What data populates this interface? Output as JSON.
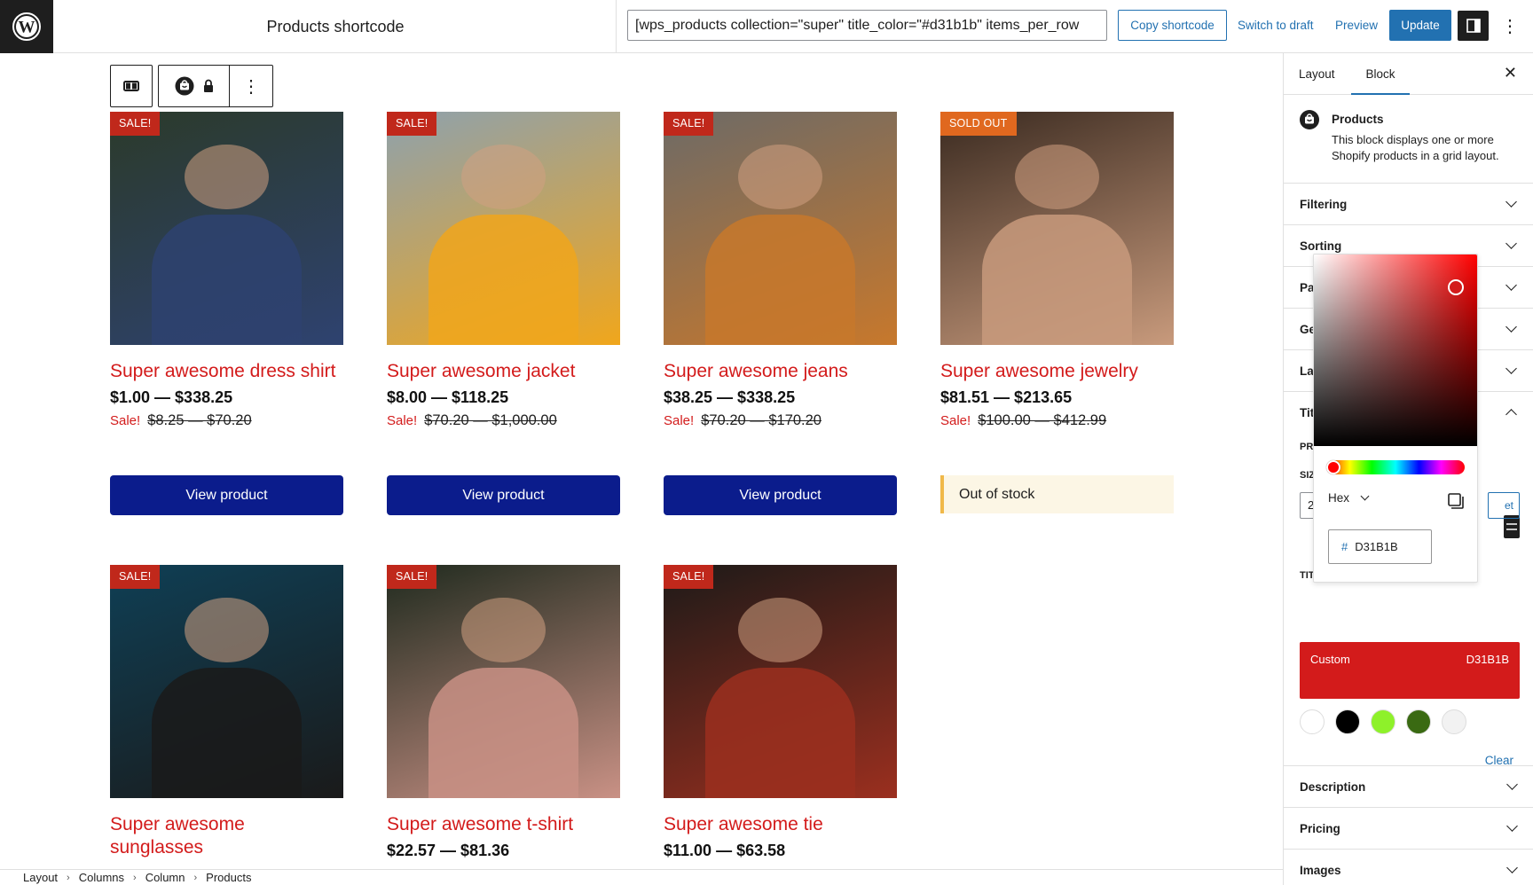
{
  "header": {
    "document_title": "Products shortcode",
    "shortcode_value": "[wps_products collection=\"super\" title_color=\"#d31b1b\" items_per_row",
    "copy_shortcode_label": "Copy shortcode",
    "switch_to_draft_label": "Switch to draft",
    "preview_label": "Preview",
    "update_label": "Update",
    "more_options_glyph": "⋮"
  },
  "block_toolbar": {
    "more_glyph": "⋮"
  },
  "products": [
    {
      "title": "Super awesome dress shirt",
      "badge": "SALE!",
      "price": "$1.00 — $338.25",
      "sale_label": "Sale!",
      "original_price": "$8.25 — $70.20",
      "action": "View product",
      "image_colors": [
        "#2b3a2a",
        "#2e4270"
      ]
    },
    {
      "title": "Super awesome jacket",
      "badge": "SALE!",
      "price": "$8.00 — $118.25",
      "sale_label": "Sale!",
      "original_price": "$70.20 — $1,000.00",
      "action": "View product",
      "image_colors": [
        "#8ea1ad",
        "#f0a61c"
      ]
    },
    {
      "title": "Super awesome jeans",
      "badge": "SALE!",
      "price": "$38.25 — $338.25",
      "sale_label": "Sale!",
      "original_price": "$70.20 — $170.20",
      "action": "View product",
      "image_colors": [
        "#6d6a66",
        "#c7782c"
      ]
    },
    {
      "title": "Super awesome jewelry",
      "badge": "SOLD OUT",
      "price": "$81.51 — $213.65",
      "sale_label": "Sale!",
      "original_price": "$100.00 — $412.99",
      "action": "Out of stock",
      "image_colors": [
        "#3a2a20",
        "#c89a7c"
      ]
    },
    {
      "title": "Super awesome sunglasses",
      "badge": "SALE!",
      "price": "",
      "sale_label": "",
      "original_price": "",
      "action": "",
      "image_colors": [
        "#0f3f55",
        "#1a1a1a"
      ]
    },
    {
      "title": "Super awesome t-shirt",
      "badge": "SALE!",
      "price": "$22.57 — $81.36",
      "sale_label": "",
      "original_price": "",
      "action": "",
      "image_colors": [
        "#1f2a1e",
        "#c99185"
      ]
    },
    {
      "title": "Super awesome tie",
      "badge": "SALE!",
      "price": "$11.00 — $63.58",
      "sale_label": "",
      "original_price": "",
      "action": "",
      "image_colors": [
        "#1d1a18",
        "#9b2f1f"
      ]
    }
  ],
  "breadcrumb": [
    "Layout",
    "Columns",
    "Column",
    "Products"
  ],
  "sidebar": {
    "tabs": [
      {
        "label": "Layout",
        "active": false
      },
      {
        "label": "Block",
        "active": true
      }
    ],
    "block_card": {
      "title": "Products",
      "description": "This block displays one or more Shopify products in a grid layout."
    },
    "panels_top": [
      {
        "label": "Filtering"
      },
      {
        "label": "Sorting"
      },
      {
        "label": "Pa"
      },
      {
        "label": "Ge"
      },
      {
        "label": "La"
      },
      {
        "label": "Tit"
      }
    ],
    "title_section": {
      "label_pr": "PR",
      "label_size": "SIZ",
      "size_value": "2",
      "reset_partial": "et",
      "label_title_color": "TIT"
    },
    "custom_color": {
      "label": "Custom",
      "value": "D31B1B",
      "hex": "#d31b1b"
    },
    "palette": [
      "#ffffff",
      "#000000",
      "#8ef12a",
      "#3a6a12",
      "#f2f2f2"
    ],
    "clear_label": "Clear",
    "panels_bottom": [
      {
        "label": "Description"
      },
      {
        "label": "Pricing"
      },
      {
        "label": "Images"
      }
    ],
    "close_glyph": "✕"
  },
  "color_picker": {
    "format": "Hex",
    "hash": "#",
    "hex_value": "D31B1B",
    "saturation": 0.87,
    "value": 0.83,
    "hue": 0
  },
  "colors": {
    "accent": "#2271b1",
    "title_color": "#d31b1b",
    "button_color": "#0b1c8c",
    "sale_badge": "#c0281b",
    "sold_out_badge": "#e0681f"
  }
}
